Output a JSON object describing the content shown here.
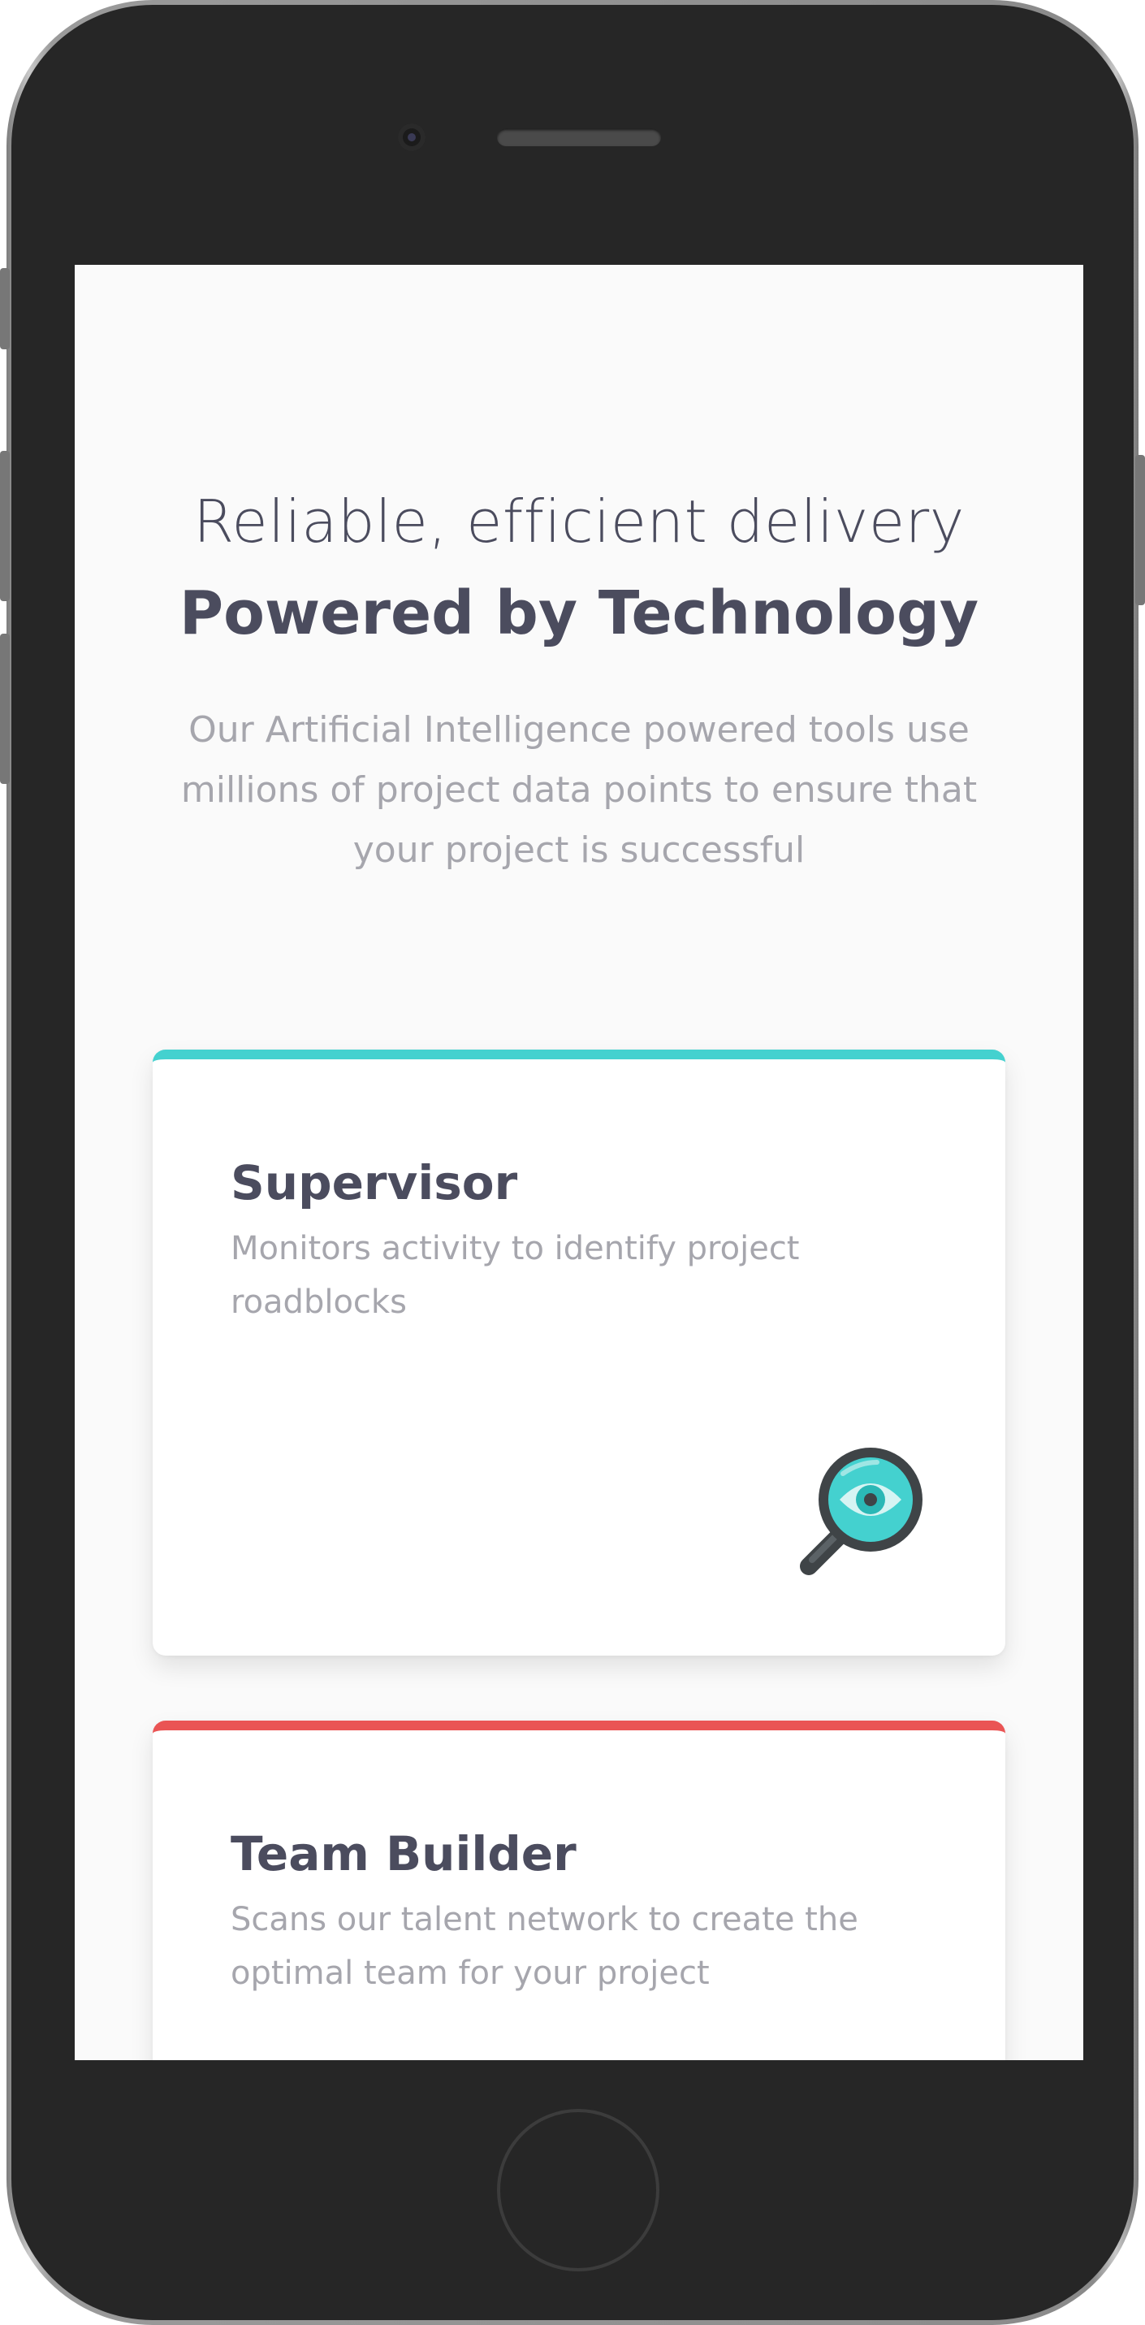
{
  "hero": {
    "lead": "Reliable, efficient delivery",
    "headline": "Powered by Technology",
    "description": "Our Artificial Intelligence powered tools use millions of project data points to ensure that your project is successful"
  },
  "cards": [
    {
      "title": "Supervisor",
      "text": "Monitors activity to identify project roadblocks",
      "accent": "#44d1cf",
      "icon": "magnifier-eye-icon"
    },
    {
      "title": "Team Builder",
      "text": "Scans our talent network to create the optimal team for your project",
      "accent": "#ea5454"
    }
  ],
  "colors": {
    "heading": "#4b4c5e",
    "body_text": "#a6a6ad",
    "screen_bg": "#fafafa",
    "cyan": "#44d1cf",
    "red": "#ea5454"
  }
}
